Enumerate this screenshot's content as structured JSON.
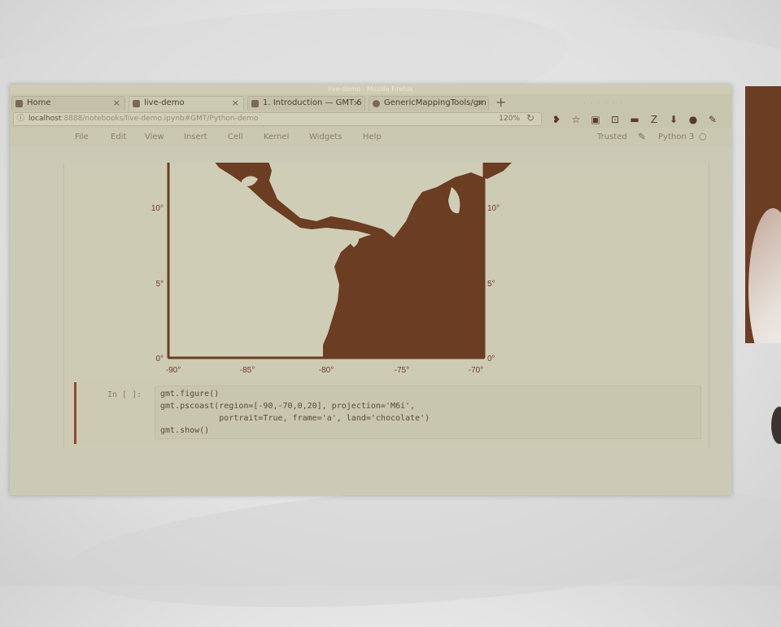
{
  "window": {
    "title": "live-demo - Mozilla Firefox"
  },
  "tabs": [
    {
      "label": "Home",
      "active": false
    },
    {
      "label": "live-demo",
      "active": true
    },
    {
      "label": "1. Introduction — GMT 6",
      "active": false
    },
    {
      "label": "GenericMappingTools/gm",
      "active": false
    }
  ],
  "url": {
    "host": "localhost",
    "path": ":8888/notebooks/live-demo.ipynb#GMT/Python-demo",
    "zoom": "120%"
  },
  "jupyter_menu": {
    "items": [
      "File",
      "Edit",
      "View",
      "Insert",
      "Cell",
      "Kernel",
      "Widgets",
      "Help"
    ],
    "trusted": "Trusted",
    "kernel": "Python 3"
  },
  "map": {
    "y_ticks": [
      "10°",
      "5°",
      "0°"
    ],
    "x_ticks": [
      "-90°",
      "-85°",
      "-80°",
      "-75°",
      "-70°"
    ],
    "land_color": "#6b3d22"
  },
  "cell": {
    "prompt": "In [ ]:",
    "code_lines": [
      "gmt.figure()",
      "gmt.pscoast(region=[-90,-70,0,20], projection='M6i',",
      "            portrait=True, frame='a', land='chocolate')",
      "gmt.show()"
    ]
  },
  "colors": {
    "accent": "#8b4a30",
    "land": "#6b3d22",
    "page_bg": "#cbcab6"
  }
}
